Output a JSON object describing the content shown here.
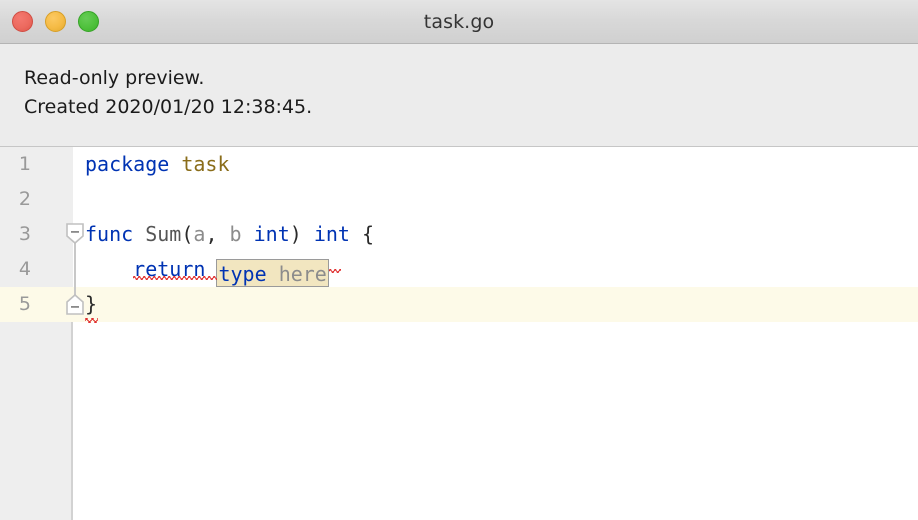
{
  "window": {
    "title": "task.go",
    "traffic_lights": [
      {
        "name": "close",
        "color": "#ec6a5f"
      },
      {
        "name": "minimize",
        "color": "#f5bb45"
      },
      {
        "name": "maximize",
        "color": "#4fc13c"
      }
    ]
  },
  "info_panel": {
    "line1": "Read-only preview.",
    "line2": "Created 2020/01/20 12:38:45."
  },
  "editor": {
    "language": "go",
    "current_line": 5,
    "colors": {
      "keyword": "#0033b3",
      "package_name": "#8a6d1a",
      "function_name": "#555555",
      "parameter": "#8c8c8c",
      "template_field_bg": "#f2e6c0",
      "template_field_border": "#9a9a9a",
      "current_line_bg": "#fdfae8",
      "gutter_bg": "#eeeeee",
      "error_squiggle": "#e03030"
    },
    "lines": [
      {
        "number": "1",
        "fold": "none"
      },
      {
        "number": "2",
        "fold": "none"
      },
      {
        "number": "3",
        "fold": "collapse-start"
      },
      {
        "number": "4",
        "fold": "none"
      },
      {
        "number": "5",
        "fold": "collapse-end"
      }
    ],
    "code": {
      "line1": {
        "keyword": "package",
        "space": " ",
        "package_name": "task"
      },
      "line2": {
        "text": ""
      },
      "line3": {
        "keyword": "func",
        "space1": " ",
        "name": "Sum",
        "paren_open": "(",
        "param_a": "a",
        "comma": ", ",
        "param_b": "b",
        "space2": " ",
        "type_b": "int",
        "paren_close": ")",
        "space3": " ",
        "return_type": "int",
        "space4": " ",
        "brace_open": "{"
      },
      "line4": {
        "indent": "    ",
        "keyword": "return",
        "space": " ",
        "template_keyword": "type",
        "template_space": " ",
        "template_text": "here"
      },
      "line5": {
        "brace_close": "}"
      }
    }
  }
}
